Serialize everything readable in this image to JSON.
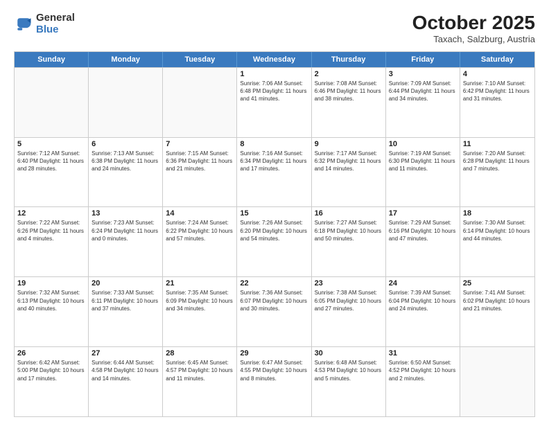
{
  "logo": {
    "general": "General",
    "blue": "Blue"
  },
  "title": "October 2025",
  "subtitle": "Taxach, Salzburg, Austria",
  "days_of_week": [
    "Sunday",
    "Monday",
    "Tuesday",
    "Wednesday",
    "Thursday",
    "Friday",
    "Saturday"
  ],
  "weeks": [
    [
      {
        "day": "",
        "info": ""
      },
      {
        "day": "",
        "info": ""
      },
      {
        "day": "",
        "info": ""
      },
      {
        "day": "1",
        "info": "Sunrise: 7:06 AM\nSunset: 6:48 PM\nDaylight: 11 hours\nand 41 minutes."
      },
      {
        "day": "2",
        "info": "Sunrise: 7:08 AM\nSunset: 6:46 PM\nDaylight: 11 hours\nand 38 minutes."
      },
      {
        "day": "3",
        "info": "Sunrise: 7:09 AM\nSunset: 6:44 PM\nDaylight: 11 hours\nand 34 minutes."
      },
      {
        "day": "4",
        "info": "Sunrise: 7:10 AM\nSunset: 6:42 PM\nDaylight: 11 hours\nand 31 minutes."
      }
    ],
    [
      {
        "day": "5",
        "info": "Sunrise: 7:12 AM\nSunset: 6:40 PM\nDaylight: 11 hours\nand 28 minutes."
      },
      {
        "day": "6",
        "info": "Sunrise: 7:13 AM\nSunset: 6:38 PM\nDaylight: 11 hours\nand 24 minutes."
      },
      {
        "day": "7",
        "info": "Sunrise: 7:15 AM\nSunset: 6:36 PM\nDaylight: 11 hours\nand 21 minutes."
      },
      {
        "day": "8",
        "info": "Sunrise: 7:16 AM\nSunset: 6:34 PM\nDaylight: 11 hours\nand 17 minutes."
      },
      {
        "day": "9",
        "info": "Sunrise: 7:17 AM\nSunset: 6:32 PM\nDaylight: 11 hours\nand 14 minutes."
      },
      {
        "day": "10",
        "info": "Sunrise: 7:19 AM\nSunset: 6:30 PM\nDaylight: 11 hours\nand 11 minutes."
      },
      {
        "day": "11",
        "info": "Sunrise: 7:20 AM\nSunset: 6:28 PM\nDaylight: 11 hours\nand 7 minutes."
      }
    ],
    [
      {
        "day": "12",
        "info": "Sunrise: 7:22 AM\nSunset: 6:26 PM\nDaylight: 11 hours\nand 4 minutes."
      },
      {
        "day": "13",
        "info": "Sunrise: 7:23 AM\nSunset: 6:24 PM\nDaylight: 11 hours\nand 0 minutes."
      },
      {
        "day": "14",
        "info": "Sunrise: 7:24 AM\nSunset: 6:22 PM\nDaylight: 10 hours\nand 57 minutes."
      },
      {
        "day": "15",
        "info": "Sunrise: 7:26 AM\nSunset: 6:20 PM\nDaylight: 10 hours\nand 54 minutes."
      },
      {
        "day": "16",
        "info": "Sunrise: 7:27 AM\nSunset: 6:18 PM\nDaylight: 10 hours\nand 50 minutes."
      },
      {
        "day": "17",
        "info": "Sunrise: 7:29 AM\nSunset: 6:16 PM\nDaylight: 10 hours\nand 47 minutes."
      },
      {
        "day": "18",
        "info": "Sunrise: 7:30 AM\nSunset: 6:14 PM\nDaylight: 10 hours\nand 44 minutes."
      }
    ],
    [
      {
        "day": "19",
        "info": "Sunrise: 7:32 AM\nSunset: 6:13 PM\nDaylight: 10 hours\nand 40 minutes."
      },
      {
        "day": "20",
        "info": "Sunrise: 7:33 AM\nSunset: 6:11 PM\nDaylight: 10 hours\nand 37 minutes."
      },
      {
        "day": "21",
        "info": "Sunrise: 7:35 AM\nSunset: 6:09 PM\nDaylight: 10 hours\nand 34 minutes."
      },
      {
        "day": "22",
        "info": "Sunrise: 7:36 AM\nSunset: 6:07 PM\nDaylight: 10 hours\nand 30 minutes."
      },
      {
        "day": "23",
        "info": "Sunrise: 7:38 AM\nSunset: 6:05 PM\nDaylight: 10 hours\nand 27 minutes."
      },
      {
        "day": "24",
        "info": "Sunrise: 7:39 AM\nSunset: 6:04 PM\nDaylight: 10 hours\nand 24 minutes."
      },
      {
        "day": "25",
        "info": "Sunrise: 7:41 AM\nSunset: 6:02 PM\nDaylight: 10 hours\nand 21 minutes."
      }
    ],
    [
      {
        "day": "26",
        "info": "Sunrise: 6:42 AM\nSunset: 5:00 PM\nDaylight: 10 hours\nand 17 minutes."
      },
      {
        "day": "27",
        "info": "Sunrise: 6:44 AM\nSunset: 4:58 PM\nDaylight: 10 hours\nand 14 minutes."
      },
      {
        "day": "28",
        "info": "Sunrise: 6:45 AM\nSunset: 4:57 PM\nDaylight: 10 hours\nand 11 minutes."
      },
      {
        "day": "29",
        "info": "Sunrise: 6:47 AM\nSunset: 4:55 PM\nDaylight: 10 hours\nand 8 minutes."
      },
      {
        "day": "30",
        "info": "Sunrise: 6:48 AM\nSunset: 4:53 PM\nDaylight: 10 hours\nand 5 minutes."
      },
      {
        "day": "31",
        "info": "Sunrise: 6:50 AM\nSunset: 4:52 PM\nDaylight: 10 hours\nand 2 minutes."
      },
      {
        "day": "",
        "info": ""
      }
    ]
  ]
}
